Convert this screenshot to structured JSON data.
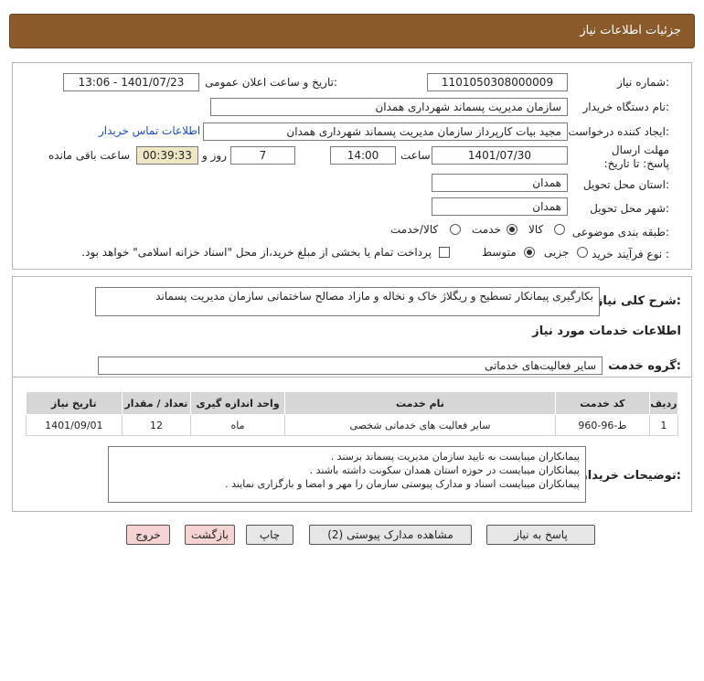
{
  "header": {
    "title": "جزئیات اطلاعات نیاز"
  },
  "info": {
    "need_number_label": "شماره نیاز:",
    "need_number": "1101050308000009",
    "announce_label": "تاریخ و ساعت اعلان عمومی:",
    "announce_value": "1401/07/23 - 13:06",
    "buyer_org_label": "نام دستگاه خریدار:",
    "buyer_org": "سازمان مدیریت پسماند شهرداری همدان",
    "requester_label": "ایجاد کننده درخواست:",
    "requester": "مجید بیات کارپرداز سازمان مدیریت پسماند شهرداری همدان",
    "contact_link": "اطلاعات تماس خریدار",
    "deadline_label": "مهلت ارسال پاسخ: تا تاریخ:",
    "deadline_date": "1401/07/30",
    "time_label": "ساعت",
    "deadline_time": "14:00",
    "days_value": "7",
    "days_label": "روز و",
    "remaining_time": "00:39:33",
    "remaining_label": "ساعت باقی مانده",
    "province_label": "استان محل تحویل:",
    "province": "همدان",
    "city_label": "شهر محل تحویل:",
    "city": "همدان",
    "category_label": "طبقه بندی موضوعی:",
    "category_options": [
      "کالا",
      "خدمت",
      "کالا/خدمت"
    ],
    "category_selected": "خدمت",
    "process_label": "نوع فرآیند خرید :",
    "process_options": [
      "جزیی",
      "متوسط"
    ],
    "process_selected": "متوسط",
    "payment_note": "پرداخت تمام یا بخشی از مبلغ خرید،از محل \"اسناد خزانه اسلامی\" خواهد بود."
  },
  "summary": {
    "label": "شرح کلی نیاز:",
    "text": "بکارگیری پیمانکار تسطیح و ریگلاژ خاک و نخاله و مازاد مصالح ساختمانی سازمان مدیریت پسماند"
  },
  "services": {
    "section_title": "اطلاعات خدمات مورد نیاز",
    "group_label": "گروه خدمت:",
    "group_value": "سایر فعالیت‌های خدماتی",
    "columns": [
      "ردیف",
      "کد خدمت",
      "نام خدمت",
      "واحد اندازه گیری",
      "تعداد / مقدار",
      "تاریخ نیاز"
    ],
    "rows": [
      {
        "row": "1",
        "code": "ط-96-960",
        "name": "سایر فعالیت های خدماتی شخصی",
        "unit": "ماه",
        "qty": "12",
        "date": "1401/09/01"
      }
    ]
  },
  "buyer_notes": {
    "label": "توضیحات خریدار:",
    "lines": [
      "پیمانکاران میبایست به تایید سازمان مدیریت پسماند برسند .",
      "پیمانکاران میبایست در حوزه استان همدان سکونت داشته باشند .",
      "پیمانکاران میبایست اسناد و مدارک پیوستی سازمان را مهر و امضا و بارگزاری نمایند ."
    ]
  },
  "buttons": {
    "reply": "پاسخ به نیاز",
    "attachments": "مشاهده مدارک پیوستی (2)",
    "print": "چاپ",
    "back": "بازگشت",
    "exit": "خروج"
  },
  "colors": {
    "header": "#8b5a2b",
    "remaining_bg": "#eee7c6",
    "link": "#1a4dc2"
  }
}
